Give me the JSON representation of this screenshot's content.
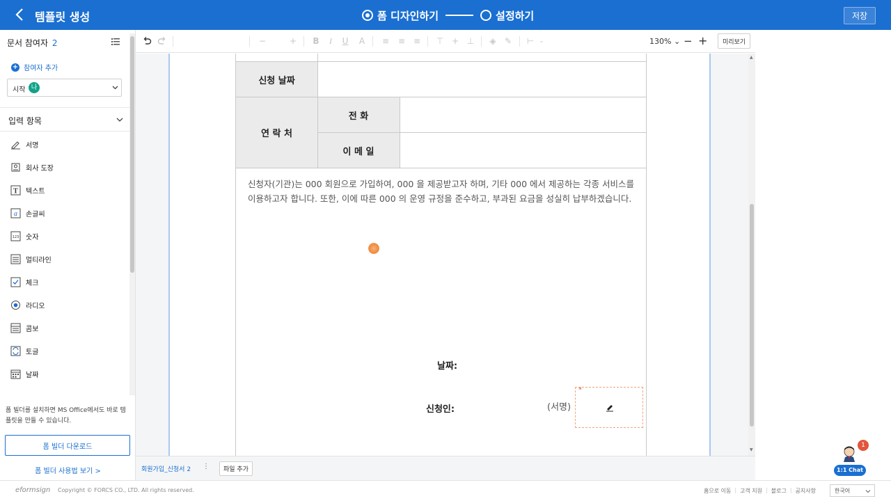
{
  "header": {
    "title": "템플릿 생성",
    "steps": [
      {
        "label": "폼 디자인하기",
        "active": true
      },
      {
        "label": "설정하기",
        "active": false
      }
    ],
    "save_label": "저장"
  },
  "sidebar": {
    "participants_label": "문서 참여자",
    "participants_count": "2",
    "add_participant_label": "참여자 추가",
    "start_label": "시작",
    "start_badge": "나",
    "section_title": "입력 항목",
    "items": [
      {
        "label": "서명",
        "icon": "signature-icon"
      },
      {
        "label": "회사 도장",
        "icon": "stamp-icon"
      },
      {
        "label": "텍스트",
        "icon": "text-icon"
      },
      {
        "label": "손글씨",
        "icon": "handwriting-icon"
      },
      {
        "label": "숫자",
        "icon": "number-icon"
      },
      {
        "label": "멀티라인",
        "icon": "multiline-icon"
      },
      {
        "label": "체크",
        "icon": "checkbox-icon"
      },
      {
        "label": "라디오",
        "icon": "radio-icon"
      },
      {
        "label": "콤보",
        "icon": "combo-icon"
      },
      {
        "label": "토글",
        "icon": "toggle-icon"
      },
      {
        "label": "날짜",
        "icon": "calendar-icon"
      }
    ],
    "note": "폼 빌더를 설치하면 MS Office에서도 바로 템플릿을 만들 수 있습니다.",
    "download_label": "폼 빌더 다운로드",
    "howto_label": "폼 빌더 사용법 보기 >"
  },
  "toolbar": {
    "zoom": "130%",
    "preview_label": "미리보기"
  },
  "document": {
    "table": {
      "apply_date_label": "신청 날짜",
      "contact_label": "연 락 처",
      "phone_label": "전 화",
      "email_label": "이 메 일"
    },
    "paragraph": "신청자(기관)는 000 회원으로 가입하여, 000 을 제공받고자 하며, 기타 000 에서 제공하는 각종 서비스를 이용하고자 합니다. 또한, 이에 따른 000 의 운영 규정을 준수하고, 부과된 요금을 성실히 납부하겠습니다.",
    "date_label": "날짜:",
    "applicant_label": "신청인:",
    "sign_label": "(서명)",
    "required_mark": "*"
  },
  "tabbar": {
    "file_tab": "회원가입_신청서 2",
    "more": "⋮",
    "add_file_label": "파일 추가"
  },
  "chat": {
    "label": "1:1 Chat",
    "badge": "1"
  },
  "footer": {
    "logo": "eformsign",
    "copyright": "Copyright © FORCS CO., LTD. All rights reserved.",
    "links": [
      "홈으로 이동",
      "고객 지원",
      "블로그",
      "공지사항"
    ],
    "language": "한국어"
  }
}
